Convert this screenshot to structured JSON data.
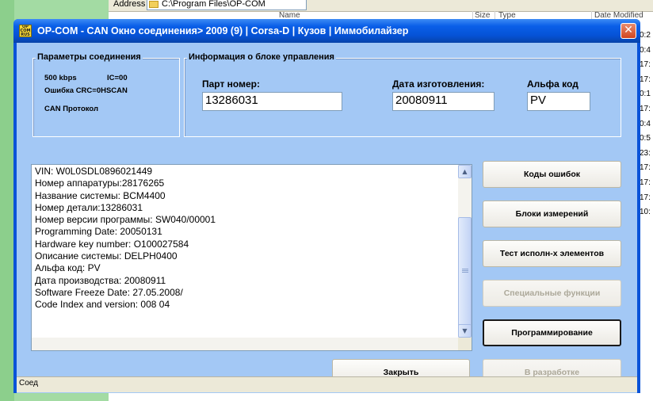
{
  "explorer": {
    "address_label": "Address",
    "address_path": "C:\\Program Files\\OP-COM",
    "columns": [
      "Name",
      "Size",
      "Type",
      "Date Modified"
    ],
    "time_stubs": [
      "0:2",
      "0:4",
      "17:",
      "17:",
      "0:1",
      "17:",
      "0:4",
      "0:5",
      "23:",
      "17:",
      "17:",
      "17:",
      "10:"
    ]
  },
  "window": {
    "title": "OP-COM - CAN Окно соединения> 2009 (9) | Corsa-D | Кузов | Иммобилайзер",
    "app_icon_text": "OP COM RUS",
    "close_glyph": "✕"
  },
  "connection": {
    "group_title": "Параметры соединения",
    "speed": "500 kbps",
    "ic": "IC=00",
    "crc_error": "Ошибка CRC=0HSCAN",
    "protocol": "CAN Протокол"
  },
  "unit_info": {
    "group_title": "Информация о блоке управления",
    "part_label": "Парт номер:",
    "part_value": "13286031",
    "date_label": "Дата изготовления:",
    "date_value": "20080911",
    "alpha_label": "Альфа код",
    "alpha_value": "PV"
  },
  "info_lines": [
    "VIN: W0L0SDL0896021449",
    "Номер аппаратуры:28176265",
    "Название системы: BCM4400",
    "Номер детали:13286031",
    "Номер версии программы: SW040/00001",
    "Programming Date: 20050131",
    "Hardware key number: O100027584",
    "Описание системы: DELPH0400",
    "Альфа код: PV",
    "Дата производства: 20080911",
    "Software Freeze Date: 27.05.2008/",
    "Code Index and version: 008 04"
  ],
  "buttons": {
    "error_codes": "Коды ошибок",
    "measure_blocks": "Блоки измерений",
    "actuator_test": "Тест исполн-х элементов",
    "special_functions": "Специальные функции",
    "programming": "Программирование",
    "close": "Закрыть",
    "in_development": "В разработке"
  },
  "status": {
    "text": "Соед"
  }
}
